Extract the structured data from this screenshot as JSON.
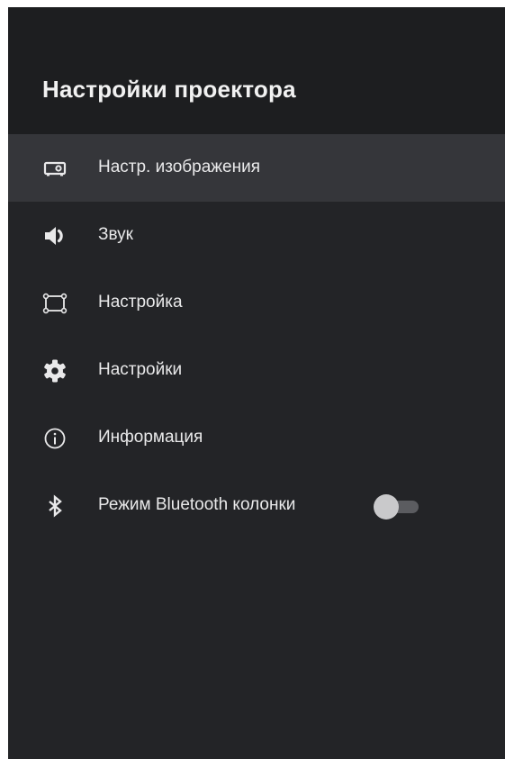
{
  "screen": {
    "title": "Настройки проектора"
  },
  "menu": {
    "items": [
      {
        "label": "Настр. изображения",
        "icon": "projector-icon",
        "selected": true
      },
      {
        "label": "Звук",
        "icon": "speaker-icon"
      },
      {
        "label": "Настройка",
        "icon": "keystone-frame-icon"
      },
      {
        "label": "Настройки",
        "icon": "gear-icon"
      },
      {
        "label": "Информация",
        "icon": "info-icon"
      },
      {
        "label": "Режим Bluetooth колонки",
        "icon": "bluetooth-icon",
        "toggle": {
          "state": "off"
        }
      }
    ]
  },
  "colors": {
    "background": "#232427",
    "header": "#1d1e20",
    "selected_row": "#35363a",
    "text": "#e9e9ea",
    "toggle_track": "#5b5c60",
    "toggle_knob": "#c9c9cb"
  }
}
